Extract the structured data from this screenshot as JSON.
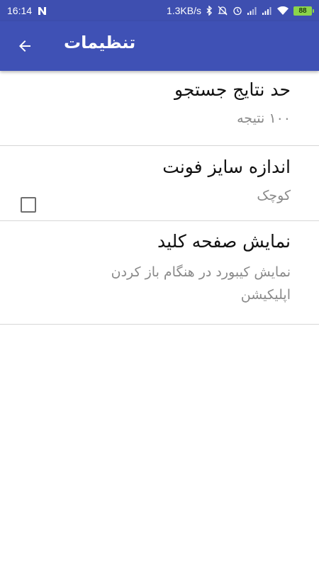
{
  "status_bar": {
    "time": "16:14",
    "network_speed": "1.3KB/s",
    "battery": "88",
    "icons": [
      "notification-n-icon",
      "bluetooth-icon",
      "mute-icon",
      "alarm-icon",
      "signal-icon",
      "signal-icon",
      "wifi-icon",
      "battery-icon"
    ]
  },
  "app_bar": {
    "title": "تنظیمات",
    "back_icon": "arrow-back-icon",
    "color": "#3f51b5"
  },
  "settings": {
    "items": [
      {
        "title": "حد نتایج جستجو",
        "summary": "۱۰۰ نتیجه"
      },
      {
        "title": "اندازه سایز فونت",
        "summary": "کوچک"
      },
      {
        "title": "نمایش صفحه کلید",
        "summary": "نمایش کیبورد در هنگام باز کردن اپلیکیشن",
        "checked": false
      }
    ]
  }
}
